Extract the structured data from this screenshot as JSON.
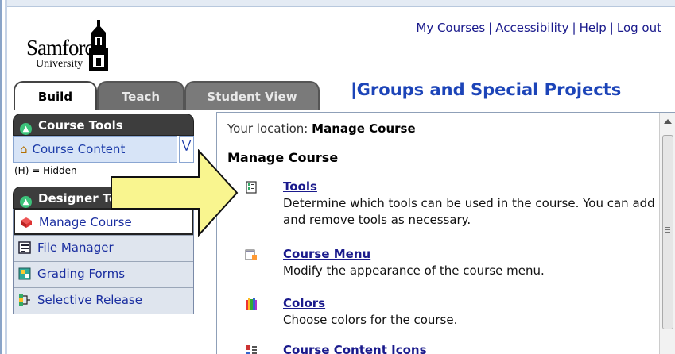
{
  "logo": {
    "name": "Samford",
    "sub": "University"
  },
  "top_links": [
    "My Courses",
    "Accessibility",
    "Help",
    "Log out"
  ],
  "tabs": {
    "build": "Build",
    "teach": "Teach",
    "student_view": "Student View"
  },
  "course_title": "|Groups and Special Projects",
  "sidebar": {
    "course_tools": {
      "heading": "Course Tools",
      "item": "Course Content",
      "hidden_note": "(H) = Hidden"
    },
    "designer_tools": {
      "heading": "Designer Tools",
      "items": [
        "Manage Course",
        "File Manager",
        "Grading Forms",
        "Selective Release"
      ]
    }
  },
  "main": {
    "location_label": "Your location:",
    "location_value": "Manage Course",
    "title": "Manage Course",
    "entries": [
      {
        "name": "Tools",
        "desc": "Determine which tools can be used in the course. You can add and remove tools as necessary.",
        "icon": "tools-icon"
      },
      {
        "name": "Course Menu",
        "desc": "Modify the appearance of the course menu.",
        "icon": "course-menu-icon"
      },
      {
        "name": "Colors",
        "desc": "Choose colors for the course.",
        "icon": "colors-icon"
      },
      {
        "name": "Course Content Icons",
        "desc": "",
        "icon": "content-icons-icon"
      }
    ]
  },
  "colors": {
    "callout_fill": "#f9f58f",
    "link": "#1a1a8c",
    "course_title": "#1c44b8"
  }
}
